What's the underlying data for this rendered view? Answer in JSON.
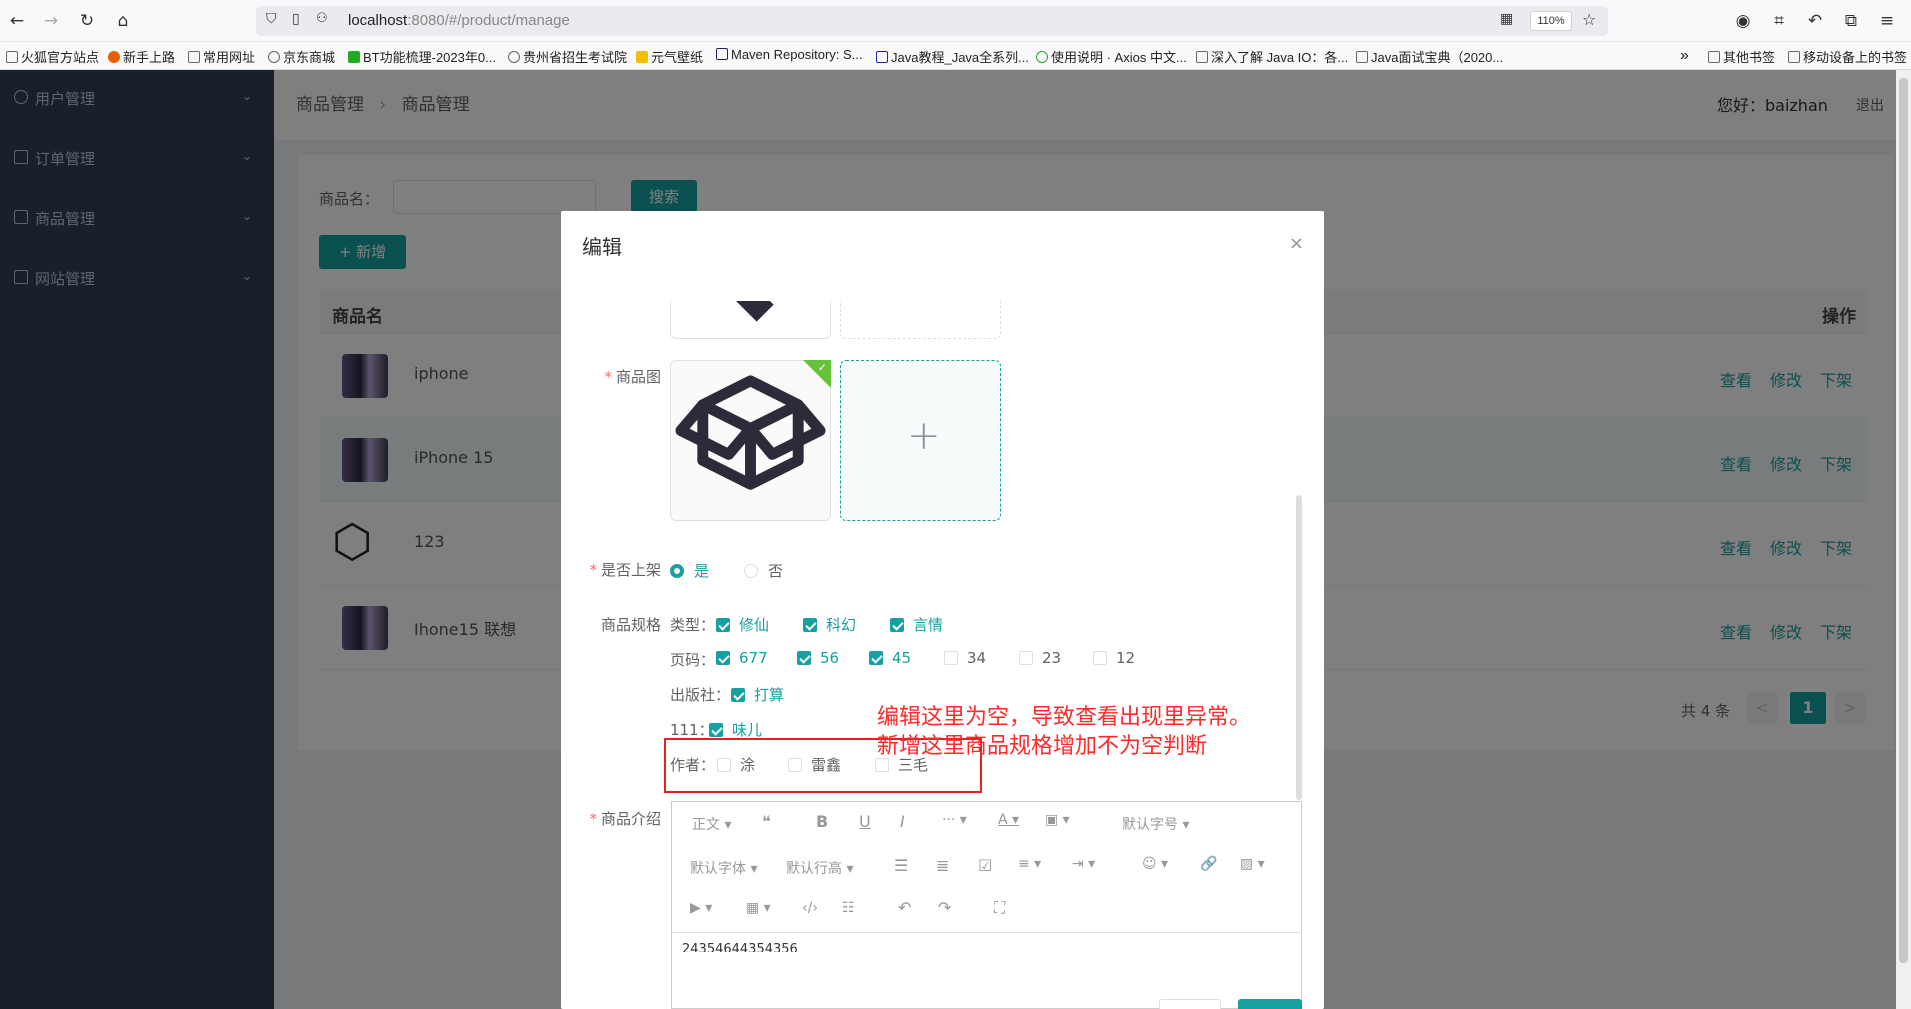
{
  "browser": {
    "url_host": "localhost",
    "url_rest": ":8080/#/product/manage",
    "zoom": "110%",
    "bookmarks": [
      "火狐官方站点",
      "新手上路",
      "常用网址",
      "京东商城",
      "BT功能梳理-2023年0...",
      "贵州省招生考试院",
      "元气壁纸",
      "Maven Repository: S...",
      "Java教程_Java全系列...",
      "使用说明 · Axios 中文...",
      "深入了解 Java IO：各...",
      "Java面试宝典（2020...",
      "其他书签",
      "移动设备上的书签"
    ]
  },
  "sidebar": {
    "items": [
      {
        "label": "用户管理"
      },
      {
        "label": "订单管理"
      },
      {
        "label": "商品管理"
      },
      {
        "label": "网站管理"
      }
    ]
  },
  "header": {
    "breadcrumb": [
      "商品管理",
      "商品管理"
    ],
    "greeting": "您好：baizhan",
    "logout": "退出"
  },
  "search": {
    "label": "商品名：",
    "button": "搜索"
  },
  "add_button": "+ 新增",
  "table": {
    "col_name": "商品名",
    "col_ops": "操作",
    "rows": [
      {
        "name": "iphone"
      },
      {
        "name": "iPhone 15"
      },
      {
        "name": "123"
      },
      {
        "name": "Ihone15 联想"
      }
    ],
    "ops": [
      "查看",
      "修改",
      "下架"
    ]
  },
  "pagination": {
    "total": "共 4 条",
    "prev": "<",
    "page": "1",
    "next": ">"
  },
  "dialog": {
    "title": "编辑",
    "close": "×",
    "image_label": "商品图",
    "shelf_label": "是否上架",
    "shelf_yes": "是",
    "shelf_no": "否",
    "spec_label": "商品规格",
    "spec_groups": [
      {
        "name": "类型：",
        "options": [
          {
            "t": "修仙",
            "on": true
          },
          {
            "t": "科幻",
            "on": true
          },
          {
            "t": "言情",
            "on": true
          }
        ]
      },
      {
        "name": "页码：",
        "options": [
          {
            "t": "677",
            "on": true
          },
          {
            "t": "56",
            "on": true
          },
          {
            "t": "45",
            "on": true
          },
          {
            "t": "34",
            "on": false
          },
          {
            "t": "23",
            "on": false
          },
          {
            "t": "12",
            "on": false
          }
        ]
      },
      {
        "name": "出版社：",
        "options": [
          {
            "t": "打算",
            "on": true
          }
        ]
      },
      {
        "name": "111：",
        "options": [
          {
            "t": "味儿",
            "on": true
          }
        ]
      },
      {
        "name": "作者：",
        "options": [
          {
            "t": "涂",
            "on": false
          },
          {
            "t": "雷鑫",
            "on": false
          },
          {
            "t": "三毛",
            "on": false
          }
        ]
      }
    ],
    "intro_label": "商品介绍",
    "editor_toolbar": {
      "para": "正文",
      "fontsize": "默认字号",
      "fontfamily": "默认字体",
      "lineheight": "默认行高"
    },
    "editor_content": "24354644354356"
  },
  "annotation": {
    "line1": "编辑这里为空，导致查看出现里异常。",
    "line2": "新增这里商品规格增加不为空判断"
  },
  "colors": {
    "accent": "#16a0a0",
    "sidebar": "#304156",
    "annot": "#ff2a2a"
  }
}
